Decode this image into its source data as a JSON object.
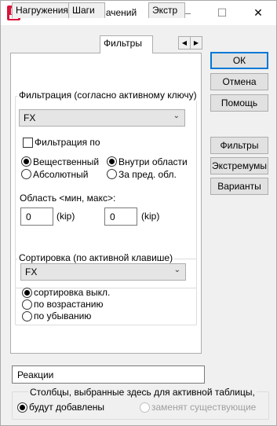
{
  "window": {
    "title": "Выбор узловых значений",
    "app_icon_letter": "R",
    "minimize_icon": "—",
    "maximize_icon": "☐",
    "close_icon": "✕"
  },
  "tabs": [
    {
      "label": "Нагружения",
      "active": false
    },
    {
      "label": "Шаги",
      "active": false
    },
    {
      "label": "Фильтры",
      "active": true
    },
    {
      "label": "Экстр",
      "active": false
    }
  ],
  "tab_scroll": {
    "left": "◀",
    "right": "▶"
  },
  "filter": {
    "group_title": "Фильтрация (согласно активному ключу)",
    "combo_value": "FX",
    "filter_checkbox_label": "Фильтрация по",
    "filter_checked": false,
    "radio_real": "Вещественный",
    "radio_abs": "Абсолютный",
    "radio_inside": "Внутри области",
    "radio_outside": "За пред. обл.",
    "range_label": "Область <мин, макс>:",
    "min_value": "0",
    "max_value": "0",
    "unit": "(kip)"
  },
  "sort": {
    "group_title": "Сортировка (по активной клавише)",
    "combo_value": "FX",
    "opt_off": "сортировка выкл.",
    "opt_asc": "по возрастанию",
    "opt_desc": "по убыванию"
  },
  "buttons": {
    "ok": "ОК",
    "cancel": "Отмена",
    "help": "Помощь",
    "filters": "Фильтры",
    "extremes": "Экстремумы",
    "variants": "Варианты"
  },
  "reactions_field": "Реакции",
  "columns": {
    "caption": "Столбцы, выбранные здесь для активной таблицы,",
    "add": "будут добавлены",
    "replace": "заменят существующие"
  },
  "chevron": "⌄"
}
